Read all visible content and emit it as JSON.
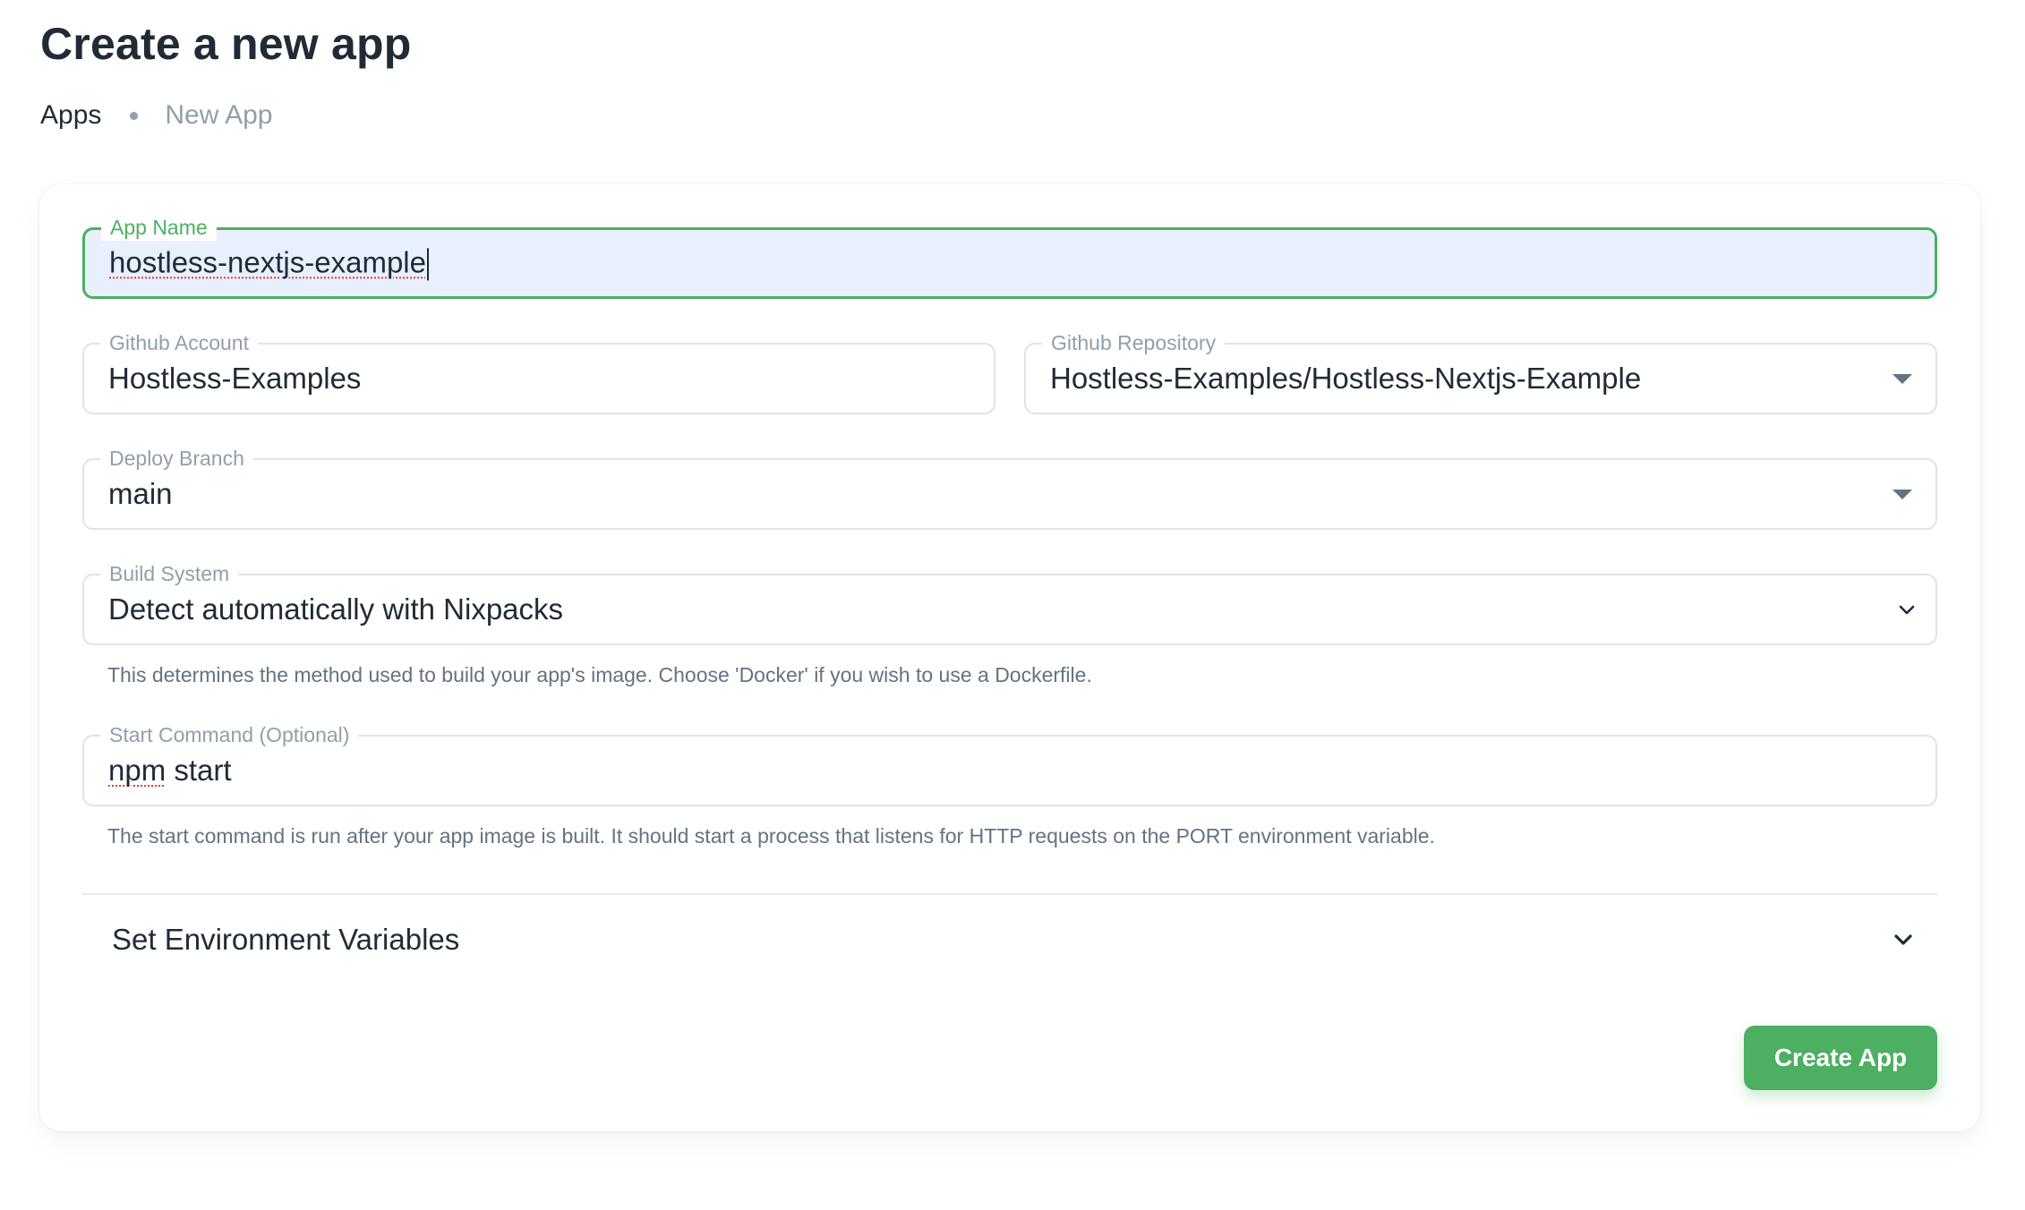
{
  "header": {
    "title": "Create a new app",
    "breadcrumb": {
      "root": "Apps",
      "current": "New App"
    }
  },
  "form": {
    "app_name": {
      "label": "App Name",
      "value": "hostless-nextjs-example"
    },
    "github_account": {
      "label": "Github Account",
      "value": "Hostless-Examples"
    },
    "github_repository": {
      "label": "Github Repository",
      "value": "Hostless-Examples/Hostless-Nextjs-Example",
      "icon": "caret-down-icon"
    },
    "deploy_branch": {
      "label": "Deploy Branch",
      "value": "main",
      "icon": "caret-down-icon"
    },
    "build_system": {
      "label": "Build System",
      "value": "Detect automatically with Nixpacks",
      "icon": "chevron-down-icon",
      "helper": "This determines the method used to build your app's image. Choose 'Docker' if you wish to use a Dockerfile."
    },
    "start_command": {
      "label": "Start Command (Optional)",
      "value_spell": "npm",
      "value_rest": " start",
      "helper": "The start command is run after your app image is built. It should start a process that listens for HTTP requests on the PORT environment variable."
    },
    "env_section": {
      "label": "Set Environment Variables",
      "icon": "chevron-down-icon"
    },
    "submit_label": "Create App"
  },
  "colors": {
    "accent": "#4caf62",
    "focused_field_bg": "#e8f0fe",
    "text_primary": "#212b36",
    "text_secondary": "#919eab"
  }
}
